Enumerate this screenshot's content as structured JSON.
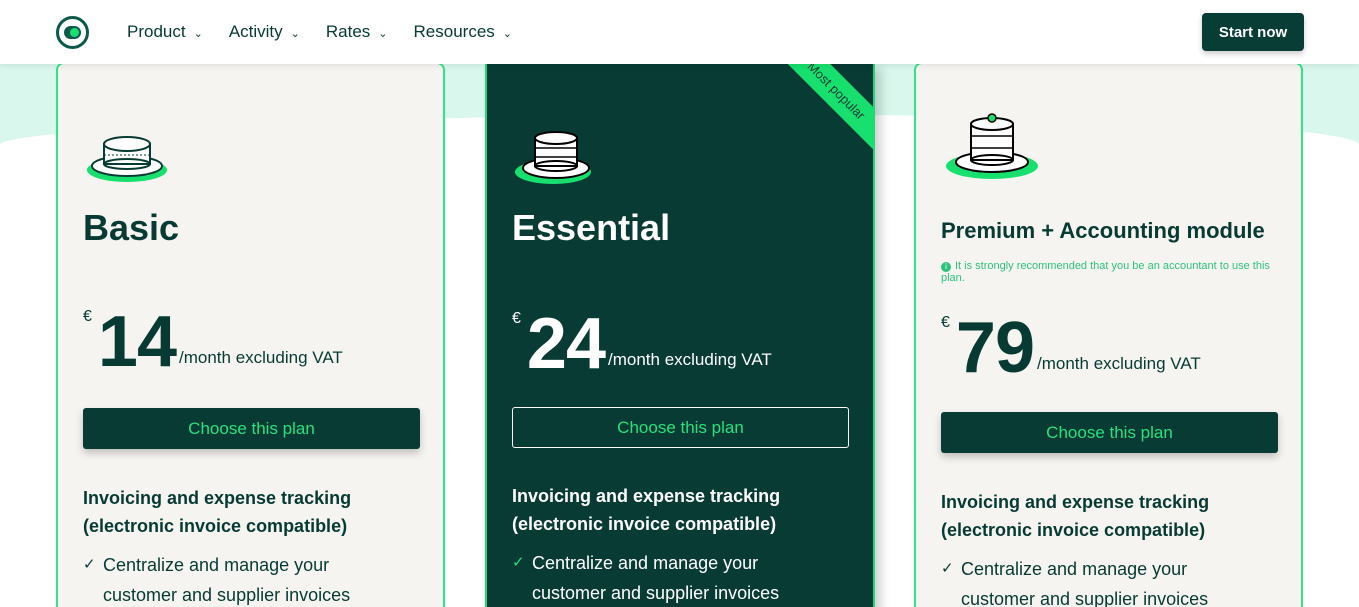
{
  "header": {
    "nav": [
      {
        "label": "Product"
      },
      {
        "label": "Activity"
      },
      {
        "label": "Rates"
      },
      {
        "label": "Resources"
      }
    ],
    "cta_label": "Start now"
  },
  "plans": [
    {
      "title": "Basic",
      "currency": "€",
      "amount": "14",
      "period": "/month excluding VAT",
      "button_label": "Choose this plan",
      "feature_title": "Invoicing and expense tracking (electronic invoice compatible)",
      "feature_item": "Centralize and manage your customer and supplier invoices"
    },
    {
      "title": "Essential",
      "ribbon": "Most popular",
      "currency": "€",
      "amount": "24",
      "period": "/month excluding VAT",
      "button_label": "Choose this plan",
      "feature_title": "Invoicing and expense tracking (electronic invoice compatible)",
      "feature_item": "Centralize and manage your customer and supplier invoices"
    },
    {
      "title": "Premium + Accounting module",
      "note": "It is strongly recommended that you be an accountant to use this plan.",
      "currency": "€",
      "amount": "79",
      "period": "/month excluding VAT",
      "button_label": "Choose this plan",
      "feature_title": "Invoicing and expense tracking (electronic invoice compatible)",
      "feature_item": "Centralize and manage your customer and supplier invoices"
    }
  ],
  "icons": {
    "logo": "brand-logo-icon",
    "chevron": "chevron-down-icon",
    "check": "check-icon",
    "info": "info-icon",
    "cake": "cake-illustration-icon"
  },
  "colors": {
    "brand_dark": "#073b34",
    "accent_green": "#18e06f",
    "card_light": "#f6f4f1",
    "mint_bg": "#d9f7ec"
  }
}
